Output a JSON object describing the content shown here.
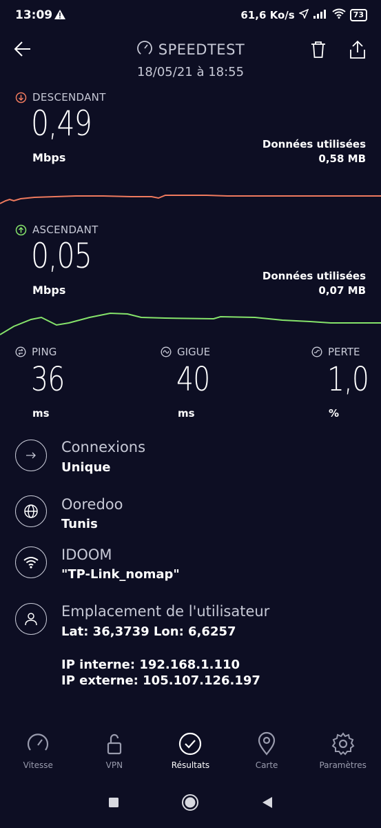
{
  "status_bar": {
    "time": "13:09",
    "net_speed": "61,6 Ko/s",
    "battery": "73"
  },
  "header": {
    "title": "SPEEDTEST",
    "date": "18/05/21 à 18:55"
  },
  "download": {
    "label": "DESCENDANT",
    "value": "0,49",
    "unit": "Mbps",
    "data_used_label": "Données utilisées",
    "data_used_value": "0,58 MB",
    "color": "#ef7a5e"
  },
  "upload": {
    "label": "ASCENDANT",
    "value": "0,05",
    "unit": "Mbps",
    "data_used_label": "Données utilisées",
    "data_used_value": "0,07 MB",
    "color": "#86e46b"
  },
  "metrics": {
    "ping": {
      "label": "PING",
      "value": "36",
      "unit": "ms"
    },
    "jitter": {
      "label": "GIGUE",
      "value": "40",
      "unit": "ms"
    },
    "loss": {
      "label": "PERTE",
      "value": "1,0",
      "unit": "%"
    }
  },
  "info": {
    "connections": {
      "title": "Connexions",
      "value": "Unique"
    },
    "provider": {
      "title": "Ooredoo",
      "value": "Tunis"
    },
    "network": {
      "title": "IDOOM",
      "value": "\"TP-Link_nomap\""
    },
    "location": {
      "title": "Emplacement de l'utilisateur",
      "value": "Lat: 36,3739 Lon: 6,6257"
    },
    "ip_internal": "IP interne: 192.168.1.110",
    "ip_external": "IP externe: 105.107.126.197"
  },
  "nav": [
    {
      "label": "Vitesse",
      "icon": "speedometer-icon"
    },
    {
      "label": "VPN",
      "icon": "lock-icon"
    },
    {
      "label": "Résultats",
      "icon": "check-circle-icon",
      "active": true
    },
    {
      "label": "Carte",
      "icon": "map-pin-icon"
    },
    {
      "label": "Paramètres",
      "icon": "gear-icon"
    }
  ]
}
